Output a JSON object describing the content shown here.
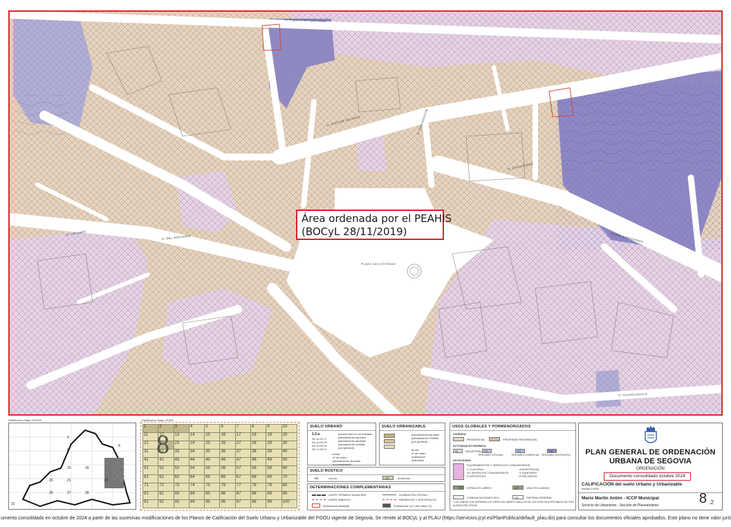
{
  "map": {
    "callout_line1": "Área ordenada por el PEAHIS",
    "callout_line2": "(BOCyL 28/11/2019)",
    "streets": [
      "C/ PUERTA DE SANTIAGO",
      "C/ DOCTOR VELASCO",
      "C/ SAN AGUSTÍN",
      "C/ CAPUCHINOS",
      "C/ VELARDE",
      "C/ DEL SOCORRO",
      "PLAZA CAPUCHINOS",
      "PLAZA SAN ESTEBAN",
      "C/ VALDELAGUILA"
    ]
  },
  "legend": {
    "distribution_label": "Distribución Hojas 1/10000",
    "distribution_label2": "Distribución Hojas 1/1000",
    "locator_numbers": [
      "3",
      "6",
      "8",
      "15",
      "16",
      "20",
      "21",
      "23",
      "26",
      "27",
      "28",
      "31"
    ],
    "big_sheet_number": "8",
    "sheet_grid": [
      [
        "1",
        "2",
        "3",
        "4",
        "5",
        "6",
        "7",
        "8",
        "9",
        "10"
      ],
      [
        "11",
        "12",
        "13",
        "14",
        "15",
        "16",
        "17",
        "18",
        "19",
        "20"
      ],
      [
        "21",
        "22",
        "23",
        "24",
        "25",
        "26",
        "27",
        "28",
        "29",
        "30"
      ],
      [
        "31",
        "32",
        "33",
        "34",
        "35",
        "36",
        "37",
        "38",
        "39",
        "40"
      ],
      [
        "41",
        "42",
        "43",
        "44",
        "45",
        "46",
        "47",
        "48",
        "49",
        "50"
      ],
      [
        "51",
        "52",
        "53",
        "54",
        "55",
        "56",
        "57",
        "58",
        "59",
        "60"
      ],
      [
        "61",
        "62",
        "63",
        "64",
        "65",
        "66",
        "67",
        "68",
        "69",
        "70"
      ],
      [
        "71",
        "72",
        "73",
        "74",
        "75",
        "76",
        "77",
        "78",
        "79",
        "80"
      ],
      [
        "81",
        "82",
        "83",
        "84",
        "85",
        "86",
        "87",
        "88",
        "89",
        "90"
      ],
      [
        "91",
        "92",
        "93",
        "94",
        "95",
        "96",
        "97",
        "98",
        "99",
        "100"
      ]
    ],
    "suelo_urbano": {
      "title": "SUELO URBANO",
      "code": "1.2.a",
      "lines": [
        "NC-A-SC-V",
        "NC-A-DG-N",
        "NC-A-DG-N",
        "NC-C-DG-Z"
      ],
      "desc": [
        "pormenores en consolidado",
        "planeamiento asumido",
        "planeamiento asumido",
        "planeamiento remitido",
        "(por general)"
      ],
      "items": [
        "borde",
        "nº de orden",
        "planeamiento asumido",
        "no consolidado"
      ]
    },
    "suelo_urbanizable": {
      "title": "SUELO URBANIZABLE",
      "items": [
        "planeamiento asumido",
        "planeamiento remitido",
        "(por general)",
        "borde",
        "nº de orden",
        "ordenación",
        "delimitado"
      ]
    },
    "suelo_rustico": {
      "title": "SUELO RÚSTICO",
      "items": [
        "común",
        "protección"
      ],
      "codes": [
        "RC",
        "RP"
      ]
    },
    "determinaciones": {
      "title": "DETERMINACIONES COMPLEMENTARIAS",
      "items": [
        "LÍMITE TÉRMINO MUNICIPAL",
        "LÍMITE ÁMBITOS",
        "ALINEACIÓN OFICIAL *",
        "PASADIZOS Y SOPORTALES",
        "Actuaciones Aisladas",
        "Ordenanzas 1y 2 (ver tabla 12)"
      ]
    },
    "usos": {
      "title": "USOS GLOBALES Y PORMENORIZADOS",
      "vivienda_title": "VIVIENDA",
      "vivienda": [
        "RESIDENCIAL",
        "PRIORIDAD RESIDENCIAL"
      ],
      "actividad_title": "ACTIVIDAD ECONÓMICA",
      "actividad": [
        "INDUSTRIAL",
        "TERCIARIO OFICINAS",
        "TERCIARIO COMERCIAL",
        "TERCIARIO HOSTELERO"
      ],
      "actividad_codes": [
        "IN",
        "TO",
        "TC",
        "TH"
      ],
      "dotacional_title": "DOTACIONAL",
      "dotacional": [
        "EQUIPAMIENTOS Y SERVICIOS COMUNITARIOS",
        "C CULTURAL",
        "SC SERVICIOS COMUNITARIOS",
        "D DEPORTIVO",
        "A ASISTENCIAL",
        "S SANITARIO",
        "R RELIGIOSO"
      ],
      "otros": [
        "ESPACIOS LIBRES",
        "VÍAS PECUARIAS",
        "COMUNICACIONES (SG)",
        "SISTEMA GENERAL"
      ],
      "otros_codes": [
        "EL",
        "VP",
        "SG"
      ],
      "note": "* LAS LÍNEAS QUE SEPARAN LOS ESPACIOS LIBRES PÚBLICOS DE LOS SUELOS EDIFICABLES NO SON ALINEACIÓN OFICIAL"
    }
  },
  "title_block": {
    "line1": "PLAN GENERAL DE ORDENACIÓN",
    "line2": "URBANA DE SEGOVIA",
    "line3": "ORDENACIÓN",
    "line4": "Documento consolidado octubre 2024",
    "line5": "CALIFICACIÓN del suelo Urbano y Urbanizable",
    "line5b": "escala 1/1000",
    "author": "Mario Martín Antón - ICCP Municipal",
    "service": "Servicio de Urbanismo - Sección de Planeamiento",
    "sheet": "8",
    "sheet_sub": ".2"
  },
  "footer": {
    "text": "umento consolidado en octubre de 2024 a partir de las sucesivas modificaciones de los Planos de Calificación del Suelo Urbano y Urbanizable del PGOU vigente de Segovia. Se remite al BOCyL y al PLAU (https://servicios.jcyl.es/PlanPublica/default_plau.do) para consultar los documentos oficiales aprobados. Este plano no tiene valor jurídico"
  },
  "colors": {
    "frame_red": "#e0282a",
    "residential_beige": "#e7d3bd",
    "priority_residential": "#d9b99b",
    "hotel_blue": "#8e88c8",
    "communities_pink": "#e6d2e8",
    "street_white": "#ffffff"
  }
}
